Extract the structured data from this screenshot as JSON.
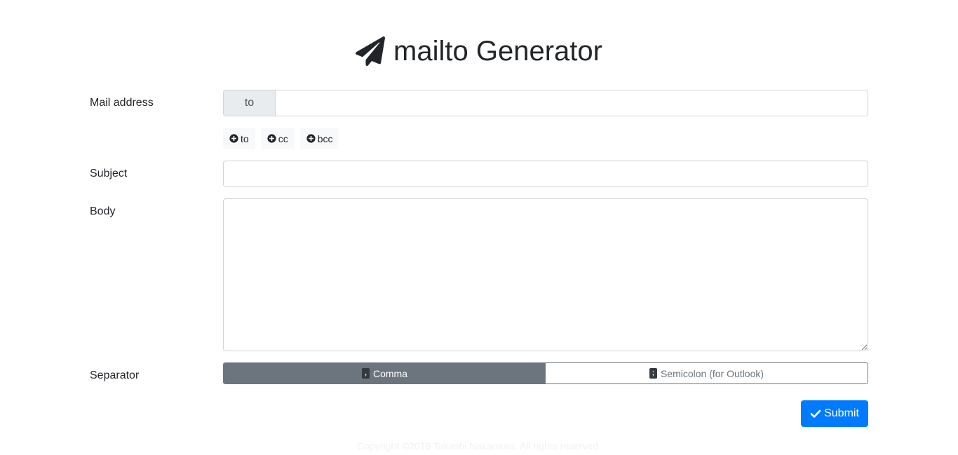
{
  "header": {
    "title": "mailto Generator",
    "icon": "paper-plane-icon"
  },
  "form": {
    "mail_address": {
      "label": "Mail address",
      "prefix": "to",
      "value": ""
    },
    "add_buttons": [
      {
        "label": "to",
        "icon": "plus-circle-icon"
      },
      {
        "label": "cc",
        "icon": "plus-circle-icon"
      },
      {
        "label": "bcc",
        "icon": "plus-circle-icon"
      }
    ],
    "subject": {
      "label": "Subject",
      "value": ""
    },
    "body": {
      "label": "Body",
      "value": ""
    },
    "separator": {
      "label": "Separator",
      "options": [
        {
          "key": ",",
          "label": "Comma",
          "selected": true
        },
        {
          "key": ";",
          "label": "Semicolon (for Outlook)",
          "selected": false
        }
      ]
    },
    "submit": {
      "label": "Submit",
      "icon": "check-icon"
    }
  },
  "footer": {
    "text": "Copyright ©2019 Takashi Nakamura. All rights reserved."
  },
  "colors": {
    "primary": "#007bff",
    "secondary": "#6c757d",
    "text": "#212529",
    "border": "#ced4da"
  }
}
